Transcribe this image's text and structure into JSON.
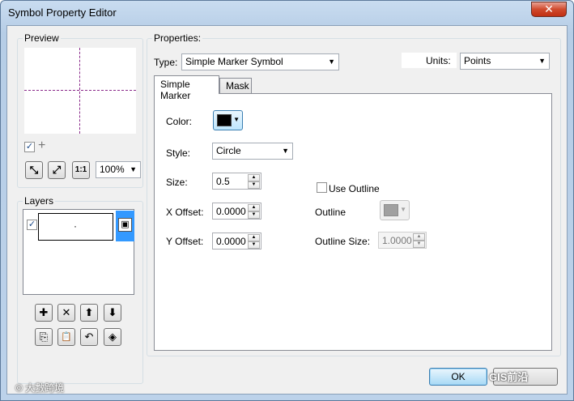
{
  "window": {
    "title": "Symbol Property Editor",
    "close_glyph": "✕"
  },
  "preview": {
    "label": "Preview",
    "zoom": "100%",
    "show_crosshair_checked": true,
    "tools": [
      {
        "name": "zoom-in-icon",
        "glyph": "⤡"
      },
      {
        "name": "fit-to-window-icon",
        "glyph": "⤢"
      },
      {
        "name": "actual-size-icon",
        "glyph": "1:1"
      }
    ]
  },
  "layers": {
    "label": "Layers",
    "items": [
      {
        "visible": true,
        "thumbnail_dot": "·"
      }
    ],
    "buttons": {
      "add": "✚",
      "remove": "✕",
      "up": "⬆",
      "down": "⬇",
      "copy": "⎘",
      "paste": "📋",
      "reset": "↶",
      "tag": "◈"
    }
  },
  "properties": {
    "label": "Properties:",
    "type_label": "Type:",
    "type_value": "Simple Marker Symbol",
    "units_label": "Units:",
    "units_value": "Points"
  },
  "tabs": [
    {
      "label": "Simple Marker",
      "active": true
    },
    {
      "label": "Mask",
      "active": false
    }
  ],
  "simple_marker": {
    "color_label": "Color:",
    "color_value": "#000000",
    "style_label": "Style:",
    "style_value": "Circle",
    "size_label": "Size:",
    "size_value": "0.5",
    "x_offset_label": "X Offset:",
    "x_offset_value": "0.0000",
    "y_offset_label": "Y Offset:",
    "y_offset_value": "0.0000",
    "use_outline_label": "Use Outline",
    "use_outline_checked": false,
    "outline_label": "Outline",
    "outline_color": "#a0a0a0",
    "outline_size_label": "Outline Size:",
    "outline_size_value": "1.0000"
  },
  "buttons": {
    "ok": "OK"
  },
  "watermarks": {
    "left": "© 大數跨境",
    "right": "GIS前沿"
  }
}
